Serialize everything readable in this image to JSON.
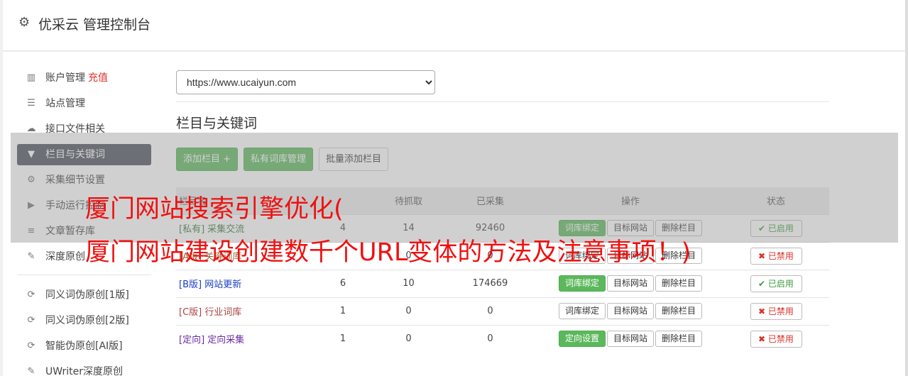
{
  "header": {
    "title": "优采云 管理控制台",
    "icon": "gear-icon"
  },
  "sidebar": {
    "items": [
      {
        "label": "账户管理",
        "extra": "充值",
        "icon": "bar-chart-icon"
      },
      {
        "label": "站点管理",
        "icon": "server-icon"
      },
      {
        "label": "接口文件相关",
        "icon": "cloud-upload-icon"
      },
      {
        "label": "栏目与关键词",
        "icon": "filter-icon",
        "active": true
      },
      {
        "label": "采集细节设置",
        "icon": "gears-icon"
      },
      {
        "label": "手动运行控制",
        "icon": "play-circle-icon"
      },
      {
        "label": "文章暂存库",
        "icon": "database-icon"
      },
      {
        "label": "深度原创",
        "icon": "edit-icon"
      }
    ],
    "items2": [
      {
        "label": "同义词伪原创[1版]",
        "icon": "refresh-icon"
      },
      {
        "label": "同义词伪原创[2版]",
        "icon": "refresh-icon"
      },
      {
        "label": "智能伪原创[AI版]",
        "icon": "refresh-icon"
      },
      {
        "label": "UWriter深度原创",
        "icon": "edit-icon"
      }
    ]
  },
  "main": {
    "site_select": "https://www.ucaiyun.com",
    "section_title": "栏目与关键词",
    "buttons": {
      "add_column": "添加栏目 +",
      "private_lib": "私有词库管理",
      "batch_add": "批量添加栏目"
    },
    "table": {
      "headers": [
        "栏目名",
        "",
        "待抓取",
        "已采集",
        "操作",
        "状态"
      ],
      "rows": [
        {
          "tag": "[私有]",
          "name": "采集交流",
          "kw": "4",
          "pending": "14",
          "collected": "92460",
          "op1": "词库绑定",
          "op1_green": true,
          "op2": "目标网站",
          "op3": "删除栏目",
          "status": "已启用",
          "on": true,
          "cls": "c-priv"
        },
        {
          "tag": "[A版]",
          "name": "关键词库",
          "kw": "",
          "pending": "0",
          "collected": "0",
          "op1": "词库绑定",
          "op1_green": false,
          "op2": "目标网站",
          "op3": "删除栏目",
          "status": "已禁用",
          "on": false,
          "cls": "c-a"
        },
        {
          "tag": "[B版]",
          "name": "网站更新",
          "kw": "6",
          "pending": "10",
          "collected": "174669",
          "op1": "词库绑定",
          "op1_green": true,
          "op2": "目标网站",
          "op3": "删除栏目",
          "status": "已启用",
          "on": true,
          "cls": "c-b"
        },
        {
          "tag": "[C版]",
          "name": "行业词库",
          "kw": "1",
          "pending": "0",
          "collected": "0",
          "op1": "词库绑定",
          "op1_green": false,
          "op2": "目标网站",
          "op3": "删除栏目",
          "status": "已禁用",
          "on": false,
          "cls": "c-c"
        },
        {
          "tag": "[定向]",
          "name": "定向采集",
          "kw": "1",
          "pending": "0",
          "collected": "0",
          "op1": "定向设置",
          "op1_green": true,
          "op2": "目标网站",
          "op3": "删除栏目",
          "status": "已禁用",
          "on": false,
          "cls": "c-d"
        }
      ]
    }
  },
  "banner": {
    "line1": "厦门网站搜索引擎优化(",
    "line2": "厦门网站建设创建数千个URL变体的方法及注意事项！)"
  }
}
